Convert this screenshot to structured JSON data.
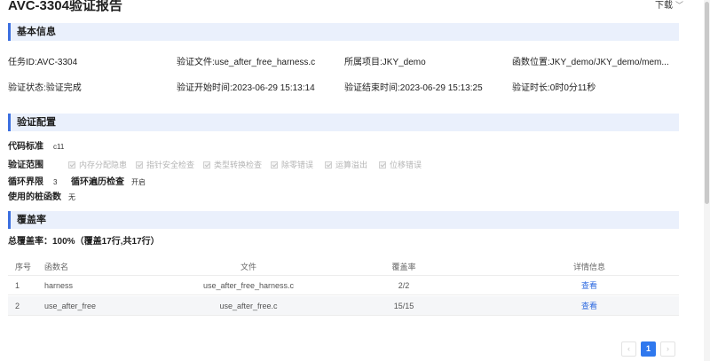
{
  "header": {
    "title": "AVC-3304验证报告",
    "download_label": "下载"
  },
  "basic": {
    "section_title": "基本信息",
    "task_id": "任务ID:AVC-3304",
    "file": "验证文件:use_after_free_harness.c",
    "project": "所属项目:JKY_demo",
    "func_location": "函数位置:JKY_demo/JKY_demo/mem...",
    "status": "验证状态:验证完成",
    "start_time": "验证开始时间:2023-06-29 15:13:14",
    "end_time": "验证结束时间:2023-06-29 15:13:25",
    "duration": "验证时长:0时0分11秒"
  },
  "config": {
    "section_title": "验证配置",
    "code_standard_label": "代码标准",
    "code_standard_value": "c11",
    "scope_label": "验证范围",
    "scope_items": [
      "内存分配隐患",
      "指针安全检查",
      "类型转换检查",
      "除零错误",
      "运算溢出",
      "位移错误"
    ],
    "loop_bound_label": "循环界限",
    "loop_bound_value": "3",
    "loop_traverse_label": "循环遍历检查",
    "loop_traverse_value": "开启",
    "stub_label": "使用的桩函数",
    "stub_value": "无"
  },
  "coverage": {
    "section_title": "覆盖率",
    "summary": "总覆盖率：100%（覆盖17行,共17行）",
    "columns": [
      "序号",
      "函数名",
      "文件",
      "覆盖率",
      "详情信息"
    ],
    "rows": [
      {
        "index": "1",
        "func": "harness",
        "file": "use_after_free_harness.c",
        "rate": "2/2",
        "detail": "查看"
      },
      {
        "index": "2",
        "func": "use_after_free",
        "file": "use_after_free.c",
        "rate": "15/15",
        "detail": "查看"
      }
    ]
  },
  "pagination": {
    "prev": "‹",
    "current": "1",
    "next": "›"
  }
}
